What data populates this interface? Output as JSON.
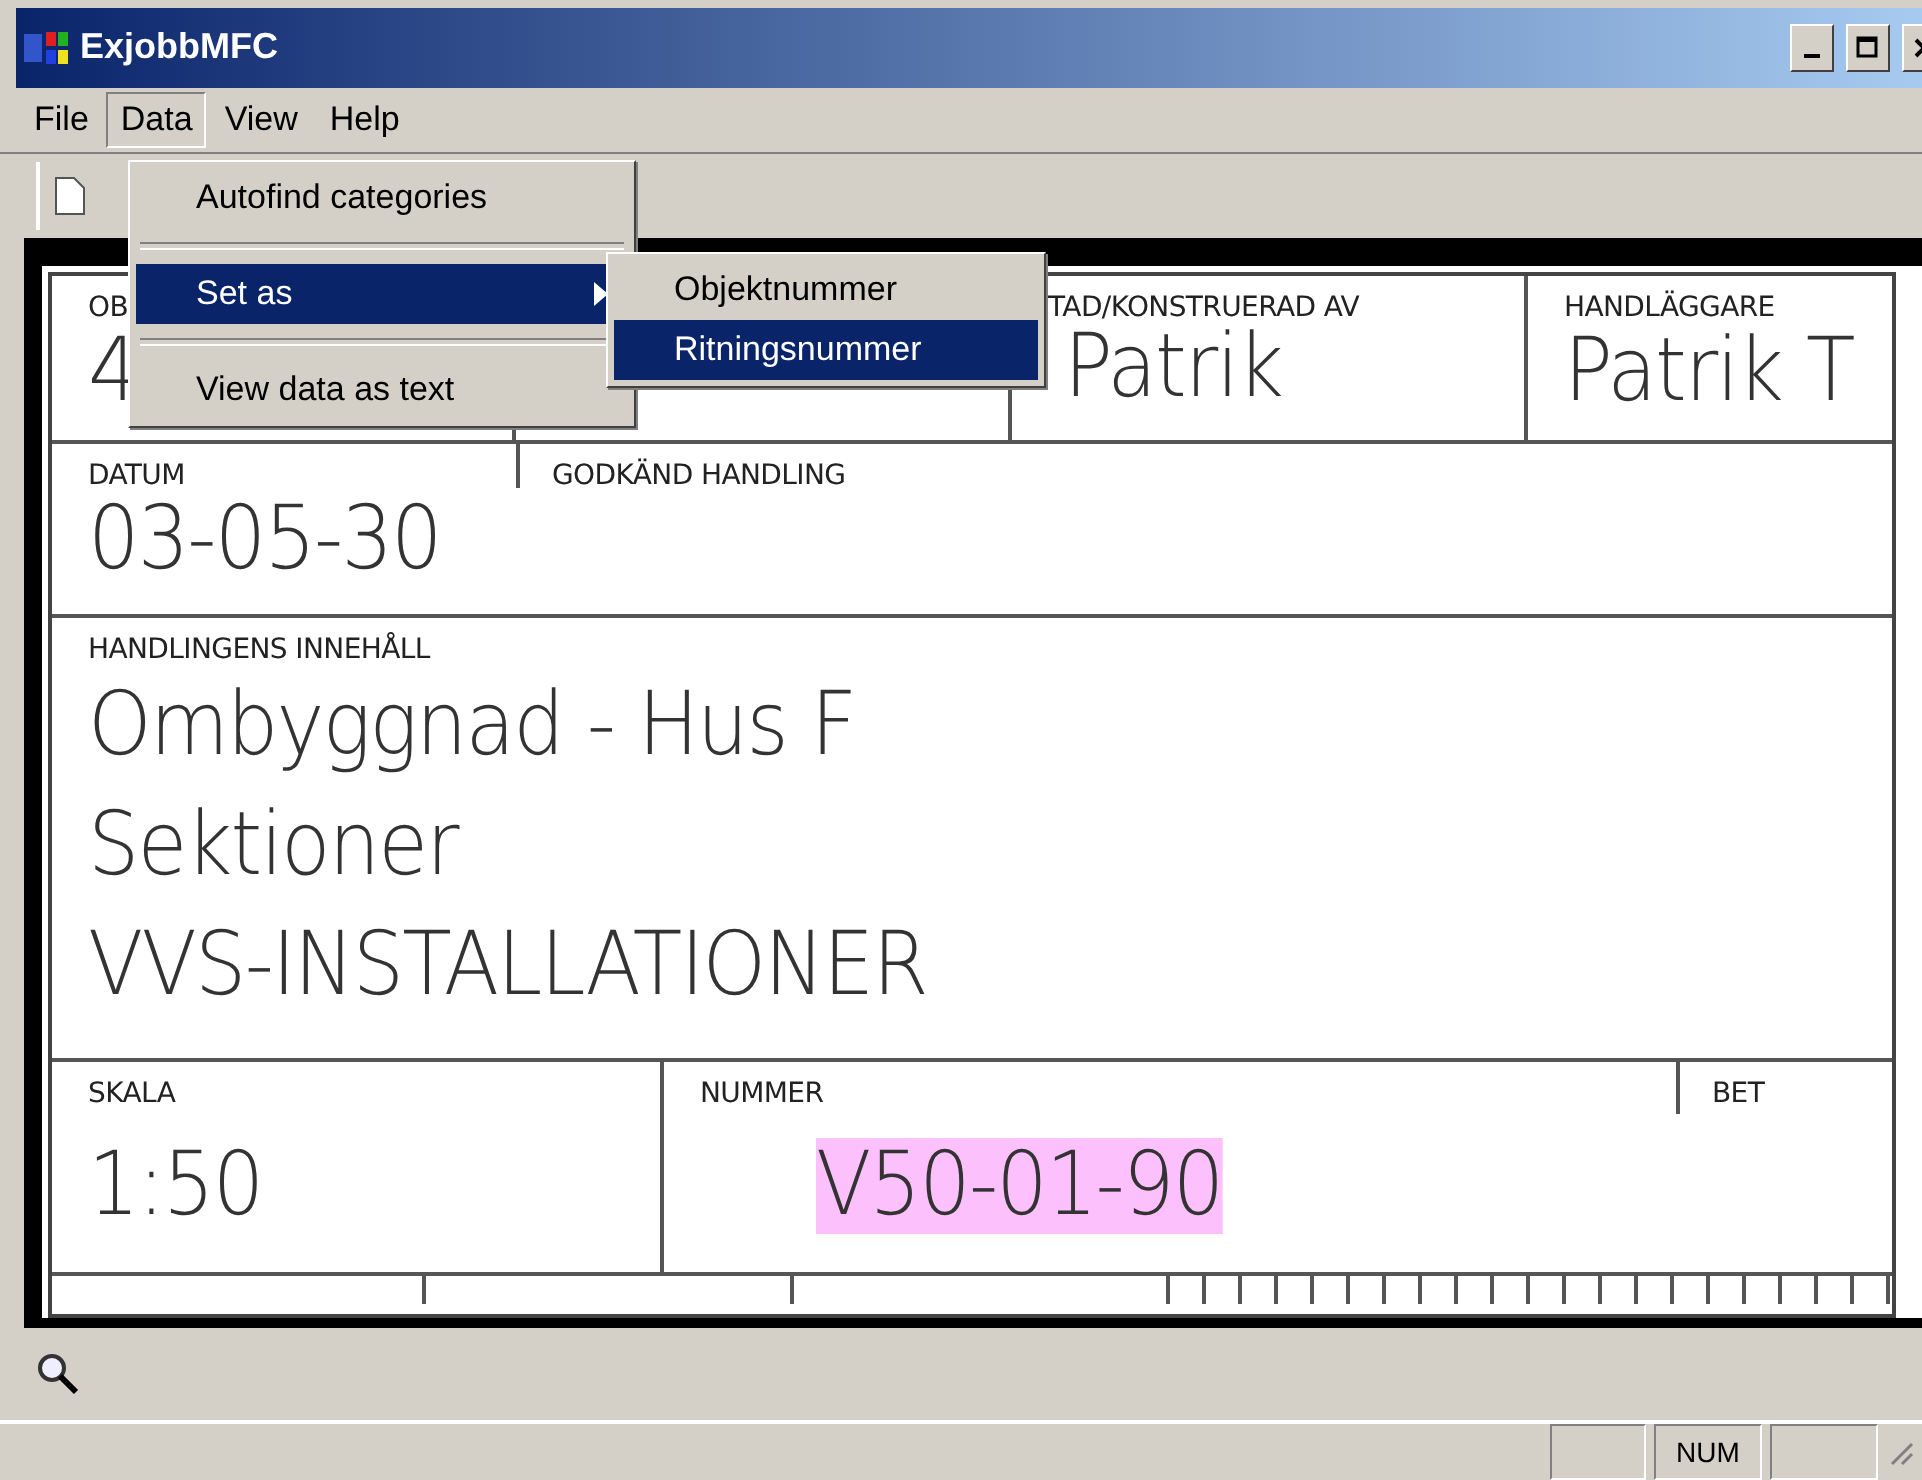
{
  "window": {
    "title": "ExjobbMFC"
  },
  "menu_bar": [
    {
      "label": "File",
      "selected": false
    },
    {
      "label": "Data",
      "selected": true
    },
    {
      "label": "View",
      "selected": false
    },
    {
      "label": "Help",
      "selected": false
    }
  ],
  "data_menu": [
    {
      "kind": "item",
      "label": "Autofind categories",
      "selected": false,
      "submenu": false
    },
    {
      "kind": "separator"
    },
    {
      "kind": "item",
      "label": "Set as",
      "selected": true,
      "submenu": true
    },
    {
      "kind": "separator"
    },
    {
      "kind": "item",
      "label": "View data as text",
      "selected": false,
      "submenu": false
    }
  ],
  "submenu": [
    {
      "label": "Objektnummer",
      "selected": false
    },
    {
      "label": "Ritningsnummer",
      "selected": true
    }
  ],
  "drawing": {
    "row_1": [
      {
        "label": "OB",
        "value": "4"
      },
      {
        "label": "TAD/KONSTRUERAD AV",
        "value": "Patrik"
      },
      {
        "label": "HANDLÄGGARE",
        "value": "Patrik T"
      }
    ],
    "row_2": [
      {
        "label": "DATUM",
        "value": "03-05-30"
      },
      {
        "label": "GODKÄND HANDLING"
      }
    ],
    "contents": {
      "label": "HANDLINGENS INNEHÅLL",
      "lines": [
        "Ombyggnad - Hus F",
        "Sektioner",
        "VVS-INSTALLATIONER"
      ]
    },
    "row_4": [
      {
        "label": "SKALA",
        "value": "1:50",
        "highlighted": false
      },
      {
        "label": "NUMMER",
        "value": "V50-01-90",
        "highlighted": true
      },
      {
        "label": "BET"
      }
    ]
  },
  "status_bar": {
    "indicators": [
      {
        "label": "NUM"
      }
    ]
  }
}
